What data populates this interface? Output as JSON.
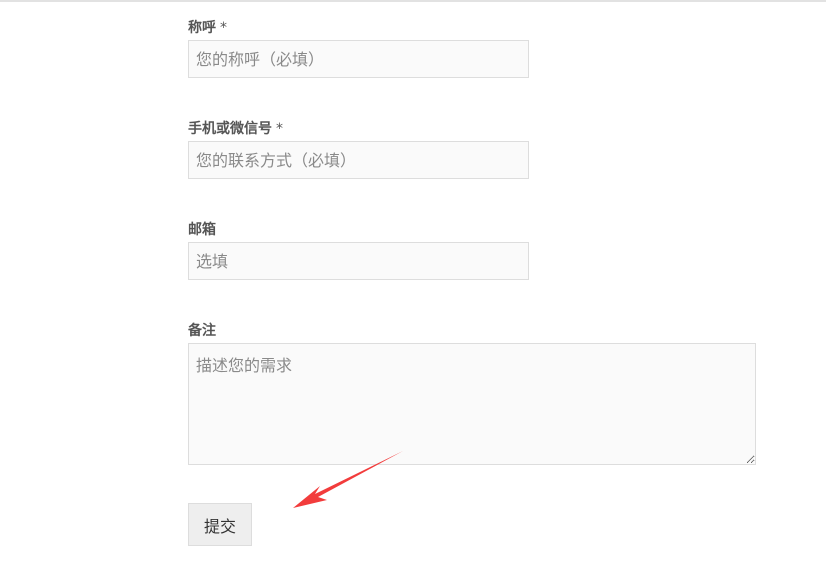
{
  "form": {
    "fields": [
      {
        "label": "称呼",
        "required_mark": "*",
        "placeholder": "您的称呼（必填）",
        "value": ""
      },
      {
        "label": "手机或微信号",
        "required_mark": "*",
        "placeholder": "您的联系方式（必填）",
        "value": ""
      },
      {
        "label": "邮箱",
        "required_mark": "",
        "placeholder": "选填",
        "value": ""
      },
      {
        "label": "备注",
        "required_mark": "",
        "placeholder": "描述您的需求",
        "value": ""
      }
    ],
    "submit_label": "提交"
  },
  "annotation": {
    "arrow_color": "#f23c3c"
  }
}
